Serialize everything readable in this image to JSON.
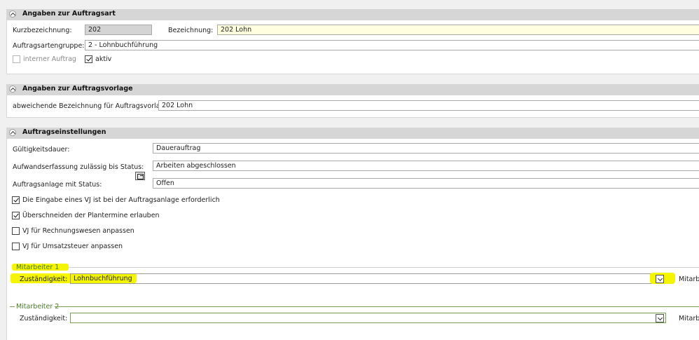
{
  "sections": {
    "auftragsart": {
      "title": "Angaben zur Auftragsart",
      "kurzbezeichnung_label": "Kurzbezeichnung:",
      "kurzbezeichnung_value": "202",
      "bezeichnung_label": "Bezeichnung:",
      "bezeichnung_value": "202 Lohn",
      "gruppe_label": "Auftragsartengruppe:",
      "gruppe_value": "2 - Lohnbuchführung",
      "interner_auftrag_label": "interner Auftrag",
      "interner_auftrag_checked": false,
      "aktiv_label": "aktiv",
      "aktiv_checked": true
    },
    "auftragsvorlage": {
      "title": "Angaben zur Auftragsvorlage",
      "abw_bezeichnung_label": "abweichende Bezeichnung für Auftragsvorlage:",
      "abw_bezeichnung_value": "202 Lohn"
    },
    "einstellungen": {
      "title": "Auftragseinstellungen",
      "gueltigkeit_label": "Gültigkeitsdauer:",
      "gueltigkeit_value": "Dauerauftrag",
      "aufwand_label": "Aufwandserfassung zulässig bis Status:",
      "aufwand_value": "Arbeiten abgeschlossen",
      "anlage_label": "Auftragsanlage mit Status:",
      "anlage_value": "Offen",
      "checkboxes": [
        {
          "label": "Die Eingabe eines VJ ist bei der Auftragsanlage erforderlich",
          "checked": true
        },
        {
          "label": "Überschneiden der Plantermine erlauben",
          "checked": true
        },
        {
          "label": "VJ für Rechnungswesen anpassen",
          "checked": false
        },
        {
          "label": "VJ für Umsatzsteuer anpassen",
          "checked": false
        }
      ],
      "mitarbeiter1": {
        "group_label": "Mitarbeiter 1",
        "zustaendigkeit_label": "Zuständigkeit:",
        "zustaendigkeit_value": "Lohnbuchführung",
        "right_label": "Mitarbe"
      },
      "mitarbeiter2": {
        "group_label": "Mitarbeiter 2",
        "zustaendigkeit_label": "Zuständigkeit:",
        "zustaendigkeit_value": "",
        "right_label": "Mitarbe"
      }
    }
  },
  "colors": {
    "highlight": "#f5f500",
    "required_field": "#ffffe0",
    "readonly_field": "#d4d4d4",
    "focus_border": "#78a050"
  }
}
